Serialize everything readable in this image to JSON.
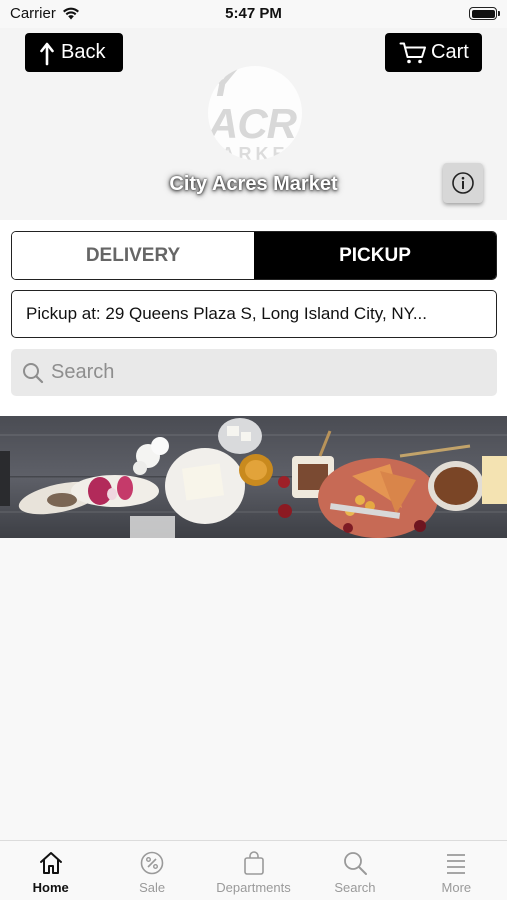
{
  "status_bar": {
    "carrier": "Carrier",
    "time": "5:47 PM"
  },
  "header": {
    "back_label": "Back",
    "cart_label": "Cart",
    "store_name": "City Acres Market",
    "logo_line1": "Y ACR",
    "logo_line2": "ARKE"
  },
  "fulfillment": {
    "options": [
      "DELIVERY",
      "PICKUP"
    ],
    "selected": "PICKUP"
  },
  "pickup_address": "Pickup at: 29 Queens Plaza S, Long Island City, NY...",
  "search": {
    "placeholder": "Search",
    "value": ""
  },
  "tab_bar": {
    "tabs": [
      {
        "label": "Home",
        "icon": "home-icon",
        "active": true
      },
      {
        "label": "Sale",
        "icon": "sale-icon",
        "active": false
      },
      {
        "label": "Departments",
        "icon": "bag-icon",
        "active": false
      },
      {
        "label": "Search",
        "icon": "search-icon",
        "active": false
      },
      {
        "label": "More",
        "icon": "menu-icon",
        "active": false
      }
    ]
  },
  "colors": {
    "primary": "#000000",
    "inactive_tab": "#9a9a9a",
    "search_bg": "#e9e9e9"
  }
}
